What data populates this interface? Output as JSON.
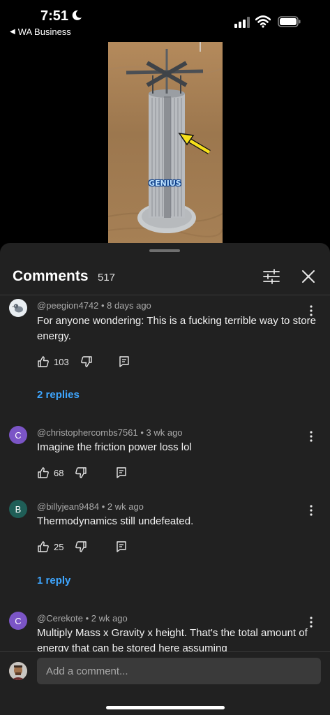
{
  "status_bar": {
    "time": "7:51",
    "back_app": "WA Business"
  },
  "video": {
    "overlay_text": "GENIUS"
  },
  "sheet": {
    "title": "Comments",
    "count": "517"
  },
  "comments": [
    {
      "avatar_type": "pigeon-image",
      "author": "@peegion4742",
      "age": "8 days ago",
      "text": "For anyone wondering: This is a fucking terrible way to store energy.",
      "likes": "103",
      "replies_label": "2 replies"
    },
    {
      "avatar_letter": "C",
      "avatar_color": "#7b55c6",
      "author": "@christophercombs7561",
      "age": "3 wk ago",
      "text": "Imagine the friction power loss lol",
      "likes": "68"
    },
    {
      "avatar_letter": "B",
      "avatar_color": "#1f5e57",
      "author": "@billyjean9484",
      "age": "2 wk ago",
      "text": "Thermodynamics still undefeated.",
      "likes": "25",
      "replies_label": "1 reply"
    },
    {
      "avatar_letter": "C",
      "avatar_color": "#7b55c6",
      "author": "@Cerekote",
      "age": "2 wk ago",
      "text": "Multiply Mass x Gravity x height. That's the total amount of energy that can be stored here assuming"
    }
  ],
  "composer": {
    "placeholder": "Add a comment..."
  },
  "colors": {
    "link": "#3ea6ff",
    "sheet_bg": "#212121"
  }
}
